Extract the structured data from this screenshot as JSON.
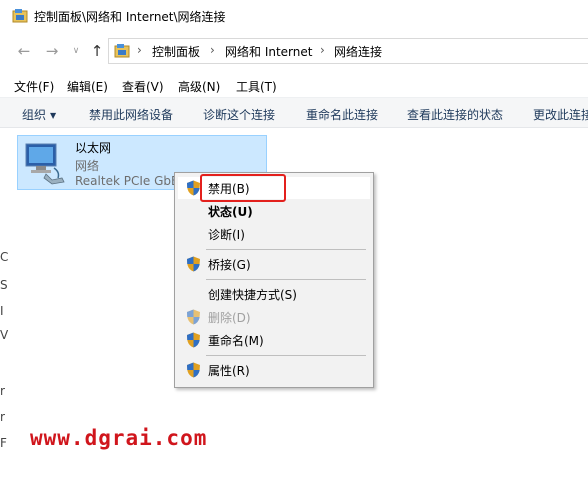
{
  "window": {
    "title": "控制面板\\网络和 Internet\\网络连接"
  },
  "address_bar": {
    "crumbs": [
      "控制面板",
      "网络和 Internet",
      "网络连接"
    ],
    "separator": "›"
  },
  "nav": {
    "back": "←",
    "forward": "→",
    "history": "∨",
    "up": "↑"
  },
  "menubar": {
    "items": [
      "文件(F)",
      "编辑(E)",
      "查看(V)",
      "高级(N)",
      "工具(T)"
    ]
  },
  "toolbar": {
    "organize": "组织",
    "caret": "▼",
    "items": [
      "禁用此网络设备",
      "诊断这个连接",
      "重命名此连接",
      "查看此连接的状态",
      "更改此连接"
    ]
  },
  "left_edge": {
    "glyphs": [
      "C",
      "S",
      "I",
      "V",
      "r",
      "r",
      "F"
    ]
  },
  "connection": {
    "name": "以太网",
    "status": "网络",
    "adapter": "Realtek PCIe GbE"
  },
  "context_menu": {
    "items": [
      {
        "label": "禁用(B)",
        "shield": true,
        "bold": false,
        "disabled": false
      },
      {
        "label": "状态(U)",
        "shield": false,
        "bold": true,
        "disabled": false
      },
      {
        "label": "诊断(I)",
        "shield": false,
        "bold": false,
        "disabled": false
      },
      {
        "label": "桥接(G)",
        "shield": true,
        "bold": false,
        "disabled": false
      },
      {
        "label": "创建快捷方式(S)",
        "shield": false,
        "bold": false,
        "disabled": false
      },
      {
        "label": "删除(D)",
        "shield": true,
        "bold": false,
        "disabled": true
      },
      {
        "label": "重命名(M)",
        "shield": true,
        "bold": false,
        "disabled": false
      },
      {
        "label": "属性(R)",
        "shield": true,
        "bold": false,
        "disabled": false
      }
    ]
  },
  "colors": {
    "selection": "#cce8ff",
    "highlight_box": "#e3201d",
    "watermark": "#d0151c"
  },
  "icons": {
    "title": "network-folder-icon",
    "connection": "ethernet-adapter-icon",
    "uac": "uac-shield-icon"
  },
  "watermark": "www.dgrai.com"
}
